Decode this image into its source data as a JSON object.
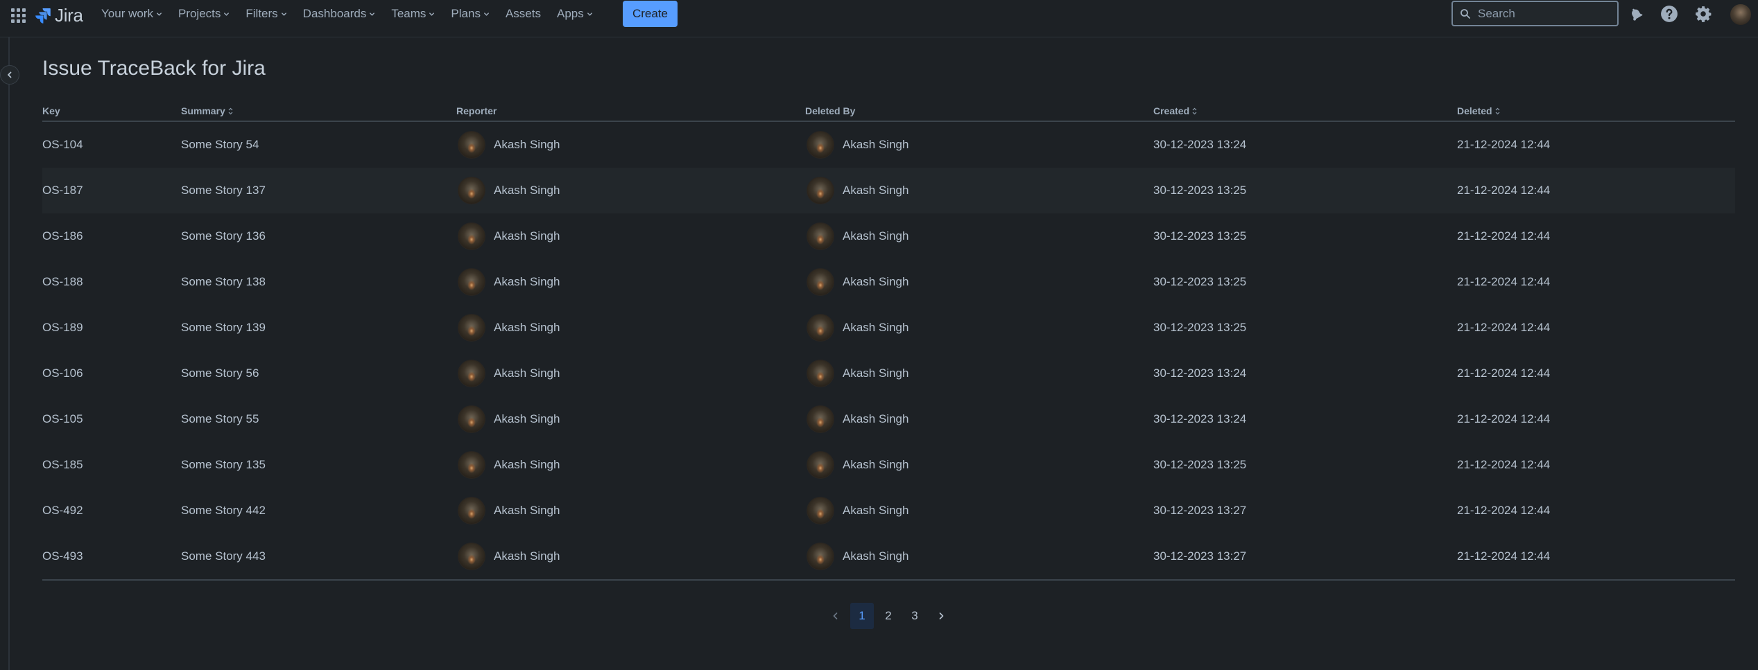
{
  "app": {
    "name": "Jira"
  },
  "nav": {
    "items": [
      {
        "label": "Your work",
        "dropdown": true
      },
      {
        "label": "Projects",
        "dropdown": true
      },
      {
        "label": "Filters",
        "dropdown": true
      },
      {
        "label": "Dashboards",
        "dropdown": true
      },
      {
        "label": "Teams",
        "dropdown": true
      },
      {
        "label": "Plans",
        "dropdown": true
      },
      {
        "label": "Assets",
        "dropdown": false
      },
      {
        "label": "Apps",
        "dropdown": true
      }
    ],
    "create_label": "Create",
    "search_placeholder": "Search",
    "icons": [
      "notifications-icon",
      "help-icon",
      "settings-icon"
    ]
  },
  "page": {
    "title": "Issue TraceBack for Jira"
  },
  "table": {
    "columns": [
      {
        "label": "Key",
        "sortable": false
      },
      {
        "label": "Summary",
        "sortable": true
      },
      {
        "label": "Reporter",
        "sortable": false
      },
      {
        "label": "Deleted By",
        "sortable": false
      },
      {
        "label": "Created",
        "sortable": true
      },
      {
        "label": "Deleted",
        "sortable": true
      }
    ],
    "rows": [
      {
        "key": "OS-104",
        "summary": "Some Story 54",
        "reporter": "Akash Singh",
        "deleted_by": "Akash Singh",
        "created": "30-12-2023 13:24",
        "deleted": "21-12-2024 12:44"
      },
      {
        "key": "OS-187",
        "summary": "Some Story 137",
        "reporter": "Akash Singh",
        "deleted_by": "Akash Singh",
        "created": "30-12-2023 13:25",
        "deleted": "21-12-2024 12:44"
      },
      {
        "key": "OS-186",
        "summary": "Some Story 136",
        "reporter": "Akash Singh",
        "deleted_by": "Akash Singh",
        "created": "30-12-2023 13:25",
        "deleted": "21-12-2024 12:44"
      },
      {
        "key": "OS-188",
        "summary": "Some Story 138",
        "reporter": "Akash Singh",
        "deleted_by": "Akash Singh",
        "created": "30-12-2023 13:25",
        "deleted": "21-12-2024 12:44"
      },
      {
        "key": "OS-189",
        "summary": "Some Story 139",
        "reporter": "Akash Singh",
        "deleted_by": "Akash Singh",
        "created": "30-12-2023 13:25",
        "deleted": "21-12-2024 12:44"
      },
      {
        "key": "OS-106",
        "summary": "Some Story 56",
        "reporter": "Akash Singh",
        "deleted_by": "Akash Singh",
        "created": "30-12-2023 13:24",
        "deleted": "21-12-2024 12:44"
      },
      {
        "key": "OS-105",
        "summary": "Some Story 55",
        "reporter": "Akash Singh",
        "deleted_by": "Akash Singh",
        "created": "30-12-2023 13:24",
        "deleted": "21-12-2024 12:44"
      },
      {
        "key": "OS-185",
        "summary": "Some Story 135",
        "reporter": "Akash Singh",
        "deleted_by": "Akash Singh",
        "created": "30-12-2023 13:25",
        "deleted": "21-12-2024 12:44"
      },
      {
        "key": "OS-492",
        "summary": "Some Story 442",
        "reporter": "Akash Singh",
        "deleted_by": "Akash Singh",
        "created": "30-12-2023 13:27",
        "deleted": "21-12-2024 12:44"
      },
      {
        "key": "OS-493",
        "summary": "Some Story 443",
        "reporter": "Akash Singh",
        "deleted_by": "Akash Singh",
        "created": "30-12-2023 13:27",
        "deleted": "21-12-2024 12:44"
      }
    ],
    "hover_row_index": 1
  },
  "pagination": {
    "pages": [
      "1",
      "2",
      "3"
    ],
    "current": "1"
  },
  "colors": {
    "accent": "#579dff",
    "background": "#1d2125",
    "text": "#b6c2cf"
  }
}
